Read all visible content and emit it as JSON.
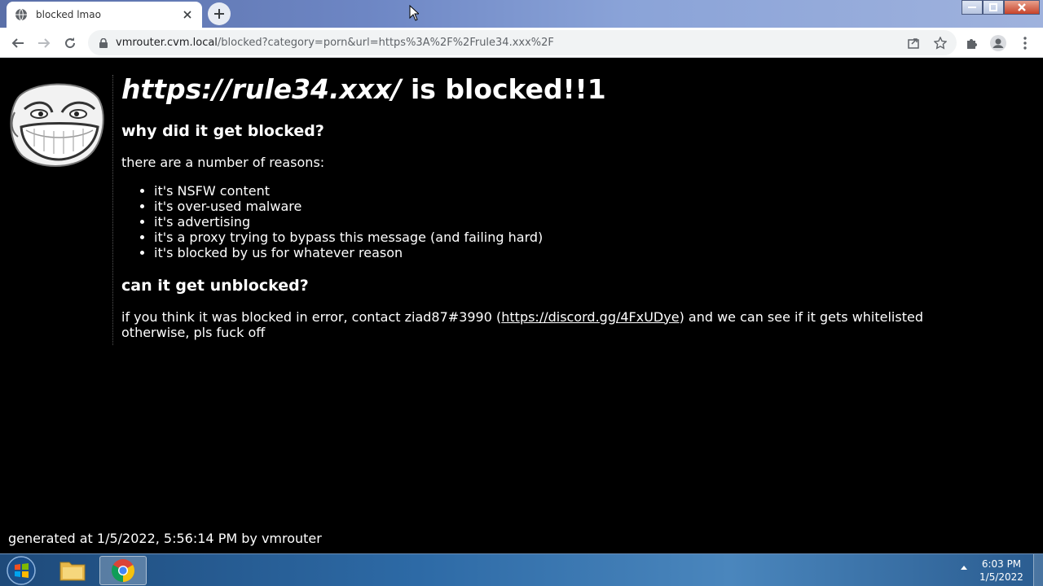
{
  "browser": {
    "tab_title": "blocked lmao",
    "url_host": "vmrouter.cvm.local",
    "url_rest": "/blocked?category=porn&url=https%3A%2F%2Frule34.xxx%2F"
  },
  "page": {
    "heading_url": "https://rule34.xxx/",
    "heading_suffix": " is blocked!!1",
    "why_heading": "why did it get blocked?",
    "reasons_intro": "there are a number of reasons:",
    "reasons": [
      "it's NSFW content",
      "it's over-used malware",
      "it's advertising",
      "it's a proxy trying to bypass this message (and failing hard)",
      "it's blocked by us for whatever reason"
    ],
    "unblock_heading": "can it get unblocked?",
    "contact_prefix": "if you think it was blocked in error, contact ziad87#3990 (",
    "contact_link": "https://discord.gg/4FxUDye",
    "contact_suffix": ") and we can see if it gets whitelisted",
    "contact_line2": "otherwise, pls fuck off",
    "generated": "generated at 1/5/2022, 5:56:14 PM by vmrouter"
  },
  "taskbar": {
    "time": "6:03 PM",
    "date": "1/5/2022"
  }
}
